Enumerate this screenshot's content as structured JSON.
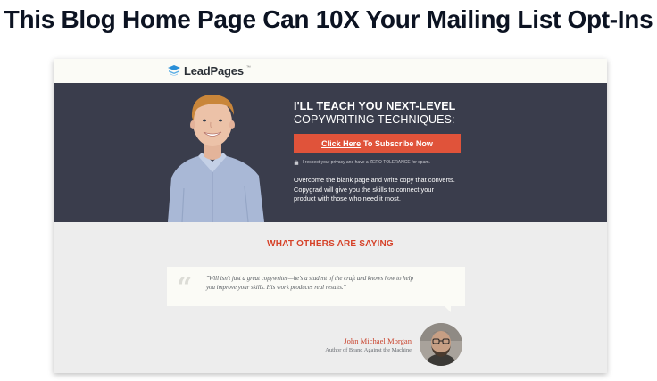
{
  "headline": "This Blog Home Page Can 10X Your Mailing List Opt-Ins",
  "colors": {
    "hero_bg": "#3a3d4c",
    "cta_bg": "#e0533a",
    "accent_red": "#d6432a",
    "page_bg": "#ededed",
    "logo_blue": "#2a8fd8"
  },
  "logo": {
    "text": "LeadPages",
    "tm": "™",
    "icon": "leadpages-logo-icon"
  },
  "hero": {
    "title_line1": "I'LL TEACH YOU NEXT-LEVEL",
    "title_line2": "COPYWRITING TECHNIQUES:",
    "cta_underlined": "Click Here",
    "cta_rest": "To Subscribe Now",
    "privacy": "I respect your privacy and have a ZERO TOLERANCE for spam.",
    "body_line1": "Overcome the blank page and write copy that converts.",
    "body_line2": "Copygrad will give you the skills to connect your",
    "body_line3": "product with those who need it most."
  },
  "testimonials": {
    "title": "WHAT OTHERS ARE SAYING",
    "quote_mark": "“",
    "quote_line1": "\"Will isn't just a great copywriter—he's a student of the craft and knows how to help",
    "quote_line2": "you improve your skills. His work produces real results.\"",
    "author_name": "John Michael Morgan",
    "author_role": "Author of Brand Against the Machine"
  }
}
